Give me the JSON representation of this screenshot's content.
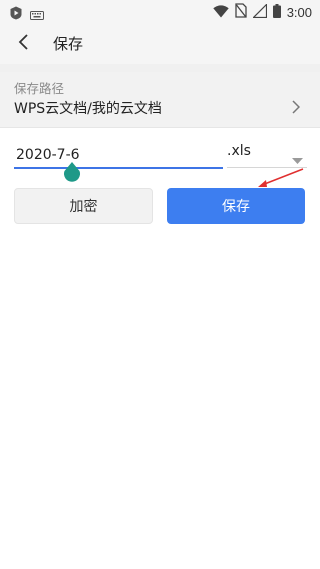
{
  "status_bar": {
    "time": "3:00",
    "icons": [
      "app-icon",
      "keyboard-icon",
      "wifi-icon",
      "no-sim-icon",
      "signal-icon",
      "battery-icon"
    ]
  },
  "toolbar": {
    "title": "保存",
    "back_icon": "chevron-left-icon"
  },
  "save_path": {
    "label": "保存路径",
    "value": "WPS云文档/我的云文档",
    "chevron_icon": "chevron-right-icon"
  },
  "filename": {
    "value": "2020-7-6",
    "extension": ".xls"
  },
  "buttons": {
    "encrypt_label": "加密",
    "save_label": "保存"
  },
  "colors": {
    "accent": "#3d7ef0",
    "underline": "#3d74e6",
    "cursor_handle": "#1e9988",
    "annotation_arrow": "#e03030"
  }
}
